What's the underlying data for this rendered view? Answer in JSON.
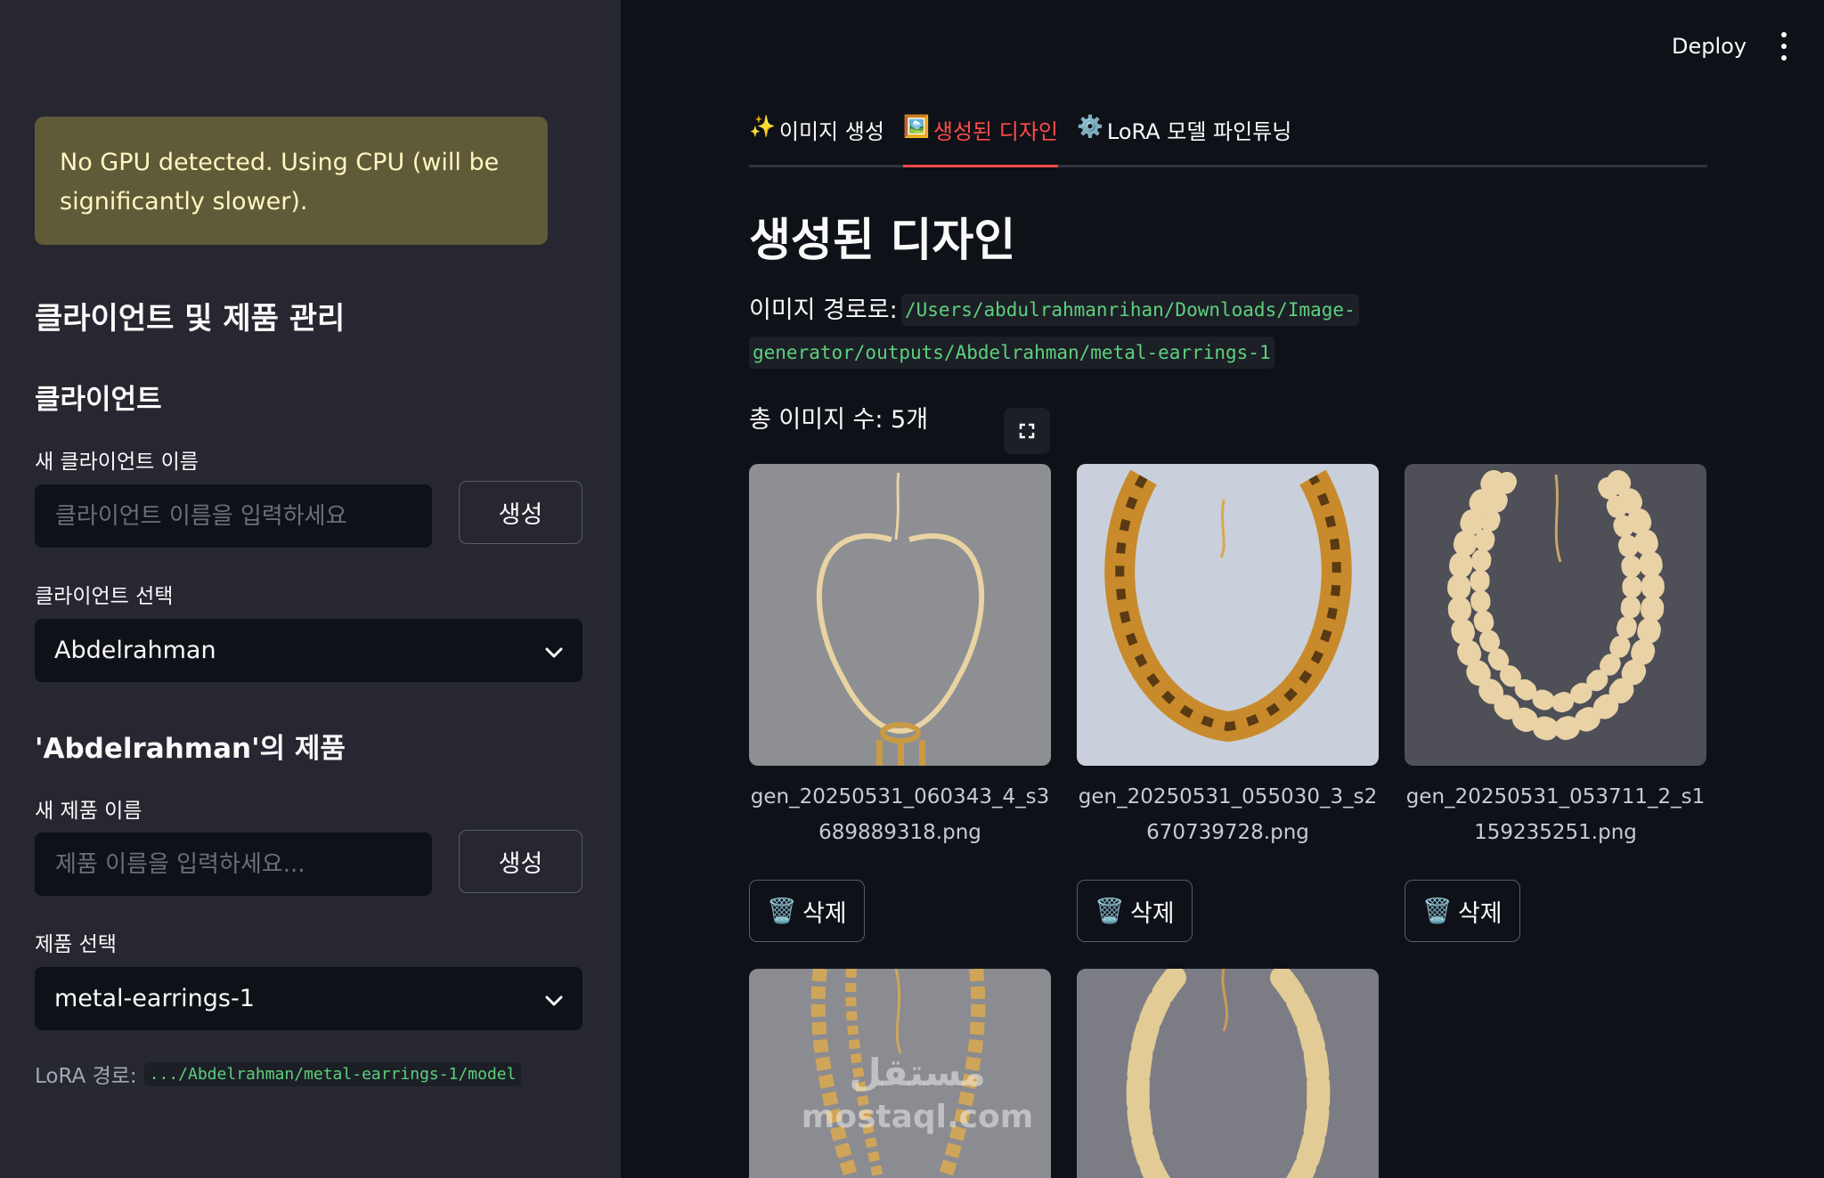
{
  "sidebar": {
    "warning": "No GPU detected. Using CPU (will be significantly slower).",
    "heading": "클라이언트 및 제품 관리",
    "client_section": {
      "heading": "클라이언트",
      "new_label": "새 클라이언트 이름",
      "new_placeholder": "클라이언트 이름을 입력하세요",
      "create_button": "생성",
      "select_label": "클라이언트 선택",
      "selected": "Abdelrahman"
    },
    "product_section": {
      "heading": "'Abdelrahman'의 제품",
      "new_label": "새 제품 이름",
      "new_placeholder": "제품 이름을 입력하세요...",
      "create_button": "생성",
      "select_label": "제품 선택",
      "selected": "metal-earrings-1"
    },
    "lora_label": "LoRA 경로:",
    "lora_path": ".../Abdelrahman/metal-earrings-1/model"
  },
  "topbar": {
    "deploy": "Deploy"
  },
  "tabs": [
    {
      "icon": "✨",
      "label": "이미지 생성",
      "active": false
    },
    {
      "icon": "🖼️",
      "label": "생성된 디자인",
      "active": true
    },
    {
      "icon": "⚙️",
      "label": "LoRA 모델 파인튜닝",
      "active": false
    }
  ],
  "main": {
    "title": "생성된 디자인",
    "path_label": "이미지 경로로:",
    "path_line1": "/Users/abdulrahmanrihan/Downloads/Image-",
    "path_line2": "generator/outputs/Abdelrahman/metal-earrings-1",
    "count": "총 이미지 수: 5개",
    "delete_icon": "🗑️",
    "delete_label": "삭제",
    "images": [
      {
        "caption": "gen_20250531_060343_4_s3689889318.png",
        "bg": "#8e8f93",
        "metal": "#e9d3a3"
      },
      {
        "caption": "gen_20250531_055030_3_s2670739728.png",
        "bg": "#c9d0db",
        "metal": "#c88a2b"
      },
      {
        "caption": "gen_20250531_053711_2_s1159235251.png",
        "bg": "#4e4f57",
        "metal": "#e8d2a6"
      },
      {
        "caption": "",
        "bg": "#8b8c91",
        "metal": "#cfa55a"
      },
      {
        "caption": "",
        "bg": "#7c7d84",
        "metal": "#e3cb96"
      }
    ]
  },
  "watermark": {
    "arabic": "مستقل",
    "latin": "mostaql.com"
  },
  "colors": {
    "accent": "#ff4b4b",
    "sidebar_bg": "#262730",
    "main_bg": "#0e1117",
    "warning_bg": "#5f5a37",
    "code_text": "#5cd17c"
  }
}
